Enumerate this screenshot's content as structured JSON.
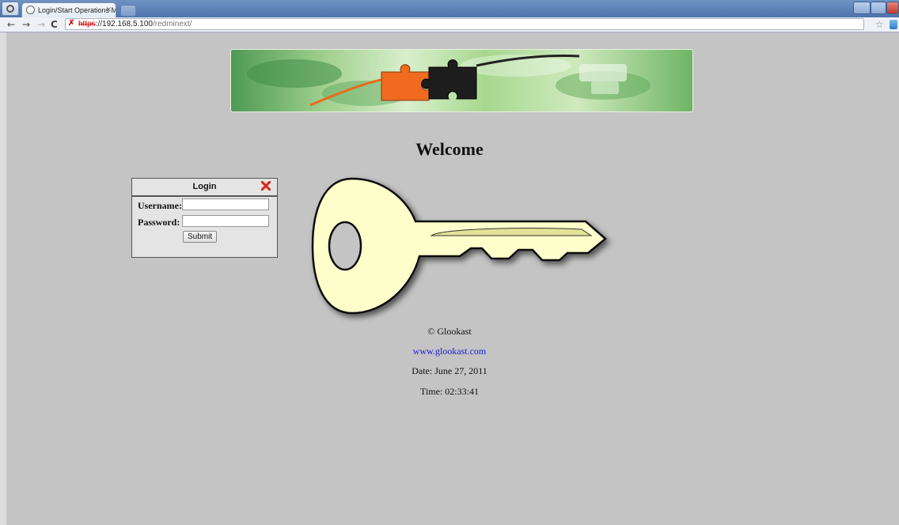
{
  "browser": {
    "tab_title": "Login/Start Operations Ma",
    "url_scheme": "https",
    "url_host": "://192.168.5.100",
    "url_path": "/redminext/",
    "icons": [
      "back-arrow-icon",
      "forward-arrow-icon",
      "reload-icon",
      "insecure-lock-icon",
      "bookmark-star-icon",
      "extension-icon"
    ]
  },
  "page": {
    "welcome": "Welcome",
    "login": {
      "title": "Login",
      "username_label": "Username:",
      "password_label": "Password:",
      "username_value": "",
      "password_value": "",
      "submit_label": "Submit"
    },
    "footer": {
      "copyright": "© Glookast",
      "website": "www.glookast.com",
      "date": "Date: June 27, 2011",
      "time": "Time: 02:33:41"
    }
  },
  "colors": {
    "page_background": "#c4c4c4",
    "key_fill": "#ffffcc",
    "link": "#1a1ad8",
    "close_icon": "#d9261c"
  }
}
